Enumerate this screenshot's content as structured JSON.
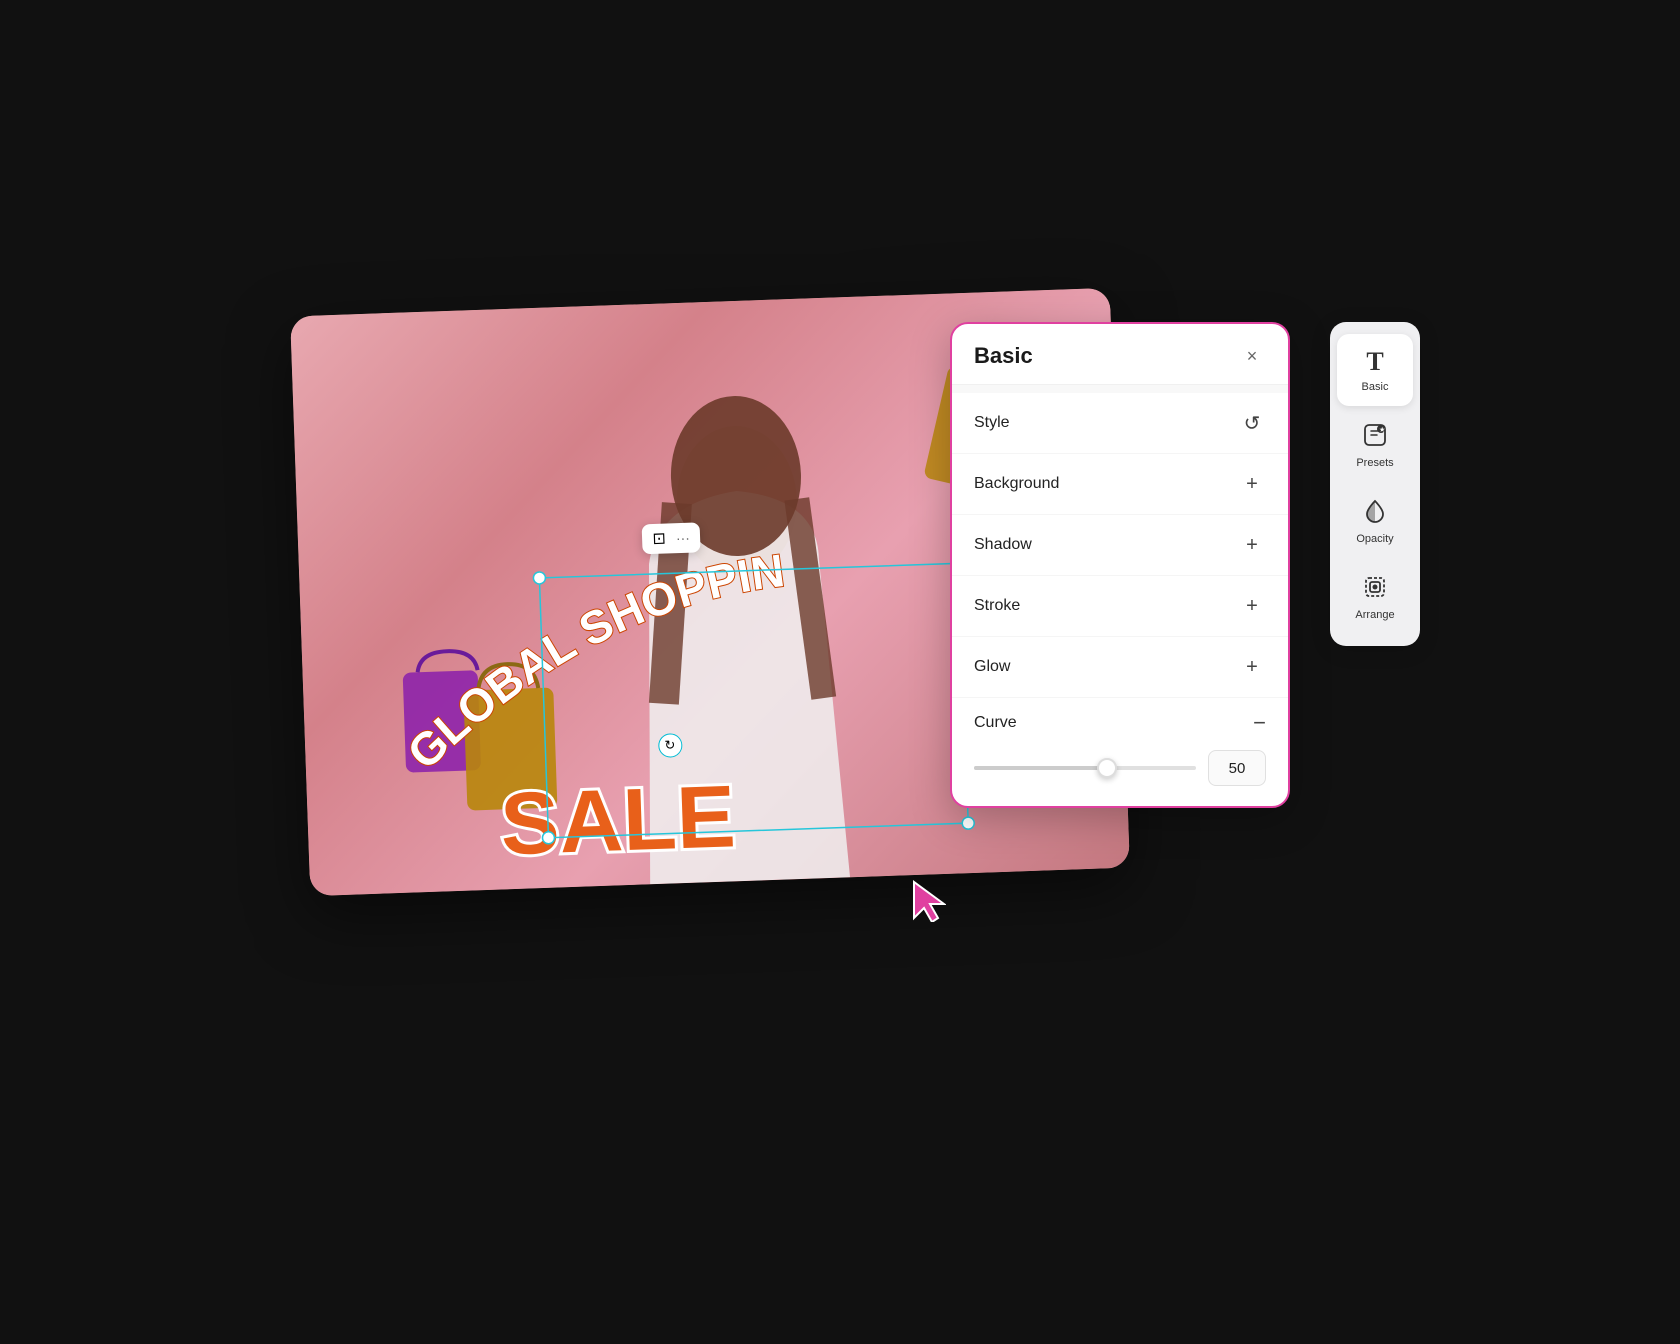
{
  "panel": {
    "title": "Basic",
    "close_label": "×",
    "rows": [
      {
        "label": "Style",
        "icon": "↺",
        "key": "style"
      },
      {
        "label": "Background",
        "icon": "+",
        "key": "background"
      },
      {
        "label": "Shadow",
        "icon": "+",
        "key": "shadow"
      },
      {
        "label": "Stroke",
        "icon": "+",
        "key": "stroke"
      },
      {
        "label": "Glow",
        "icon": "+",
        "key": "glow"
      }
    ],
    "curve": {
      "label": "Curve",
      "icon": "−",
      "value": "50",
      "slider_percent": 60
    }
  },
  "sidebar": {
    "items": [
      {
        "label": "Basic",
        "icon": "T",
        "active": true
      },
      {
        "label": "Presets",
        "icon": "⊡★",
        "active": false
      },
      {
        "label": "Opacity",
        "icon": "◈",
        "active": false
      },
      {
        "label": "Arrange",
        "icon": "⊞",
        "active": false
      }
    ]
  },
  "canvas": {
    "text_top": "GLOBAL SHOPPIN",
    "text_main": "SALE",
    "toolbar": {
      "icon1": "⊡",
      "icon2": "···"
    }
  },
  "colors": {
    "accent_pink": "#e040a0",
    "panel_border": "#e040a0",
    "canvas_bg": "#d4818a",
    "sale_color": "#e8601a",
    "selection_border": "#26c6da"
  }
}
